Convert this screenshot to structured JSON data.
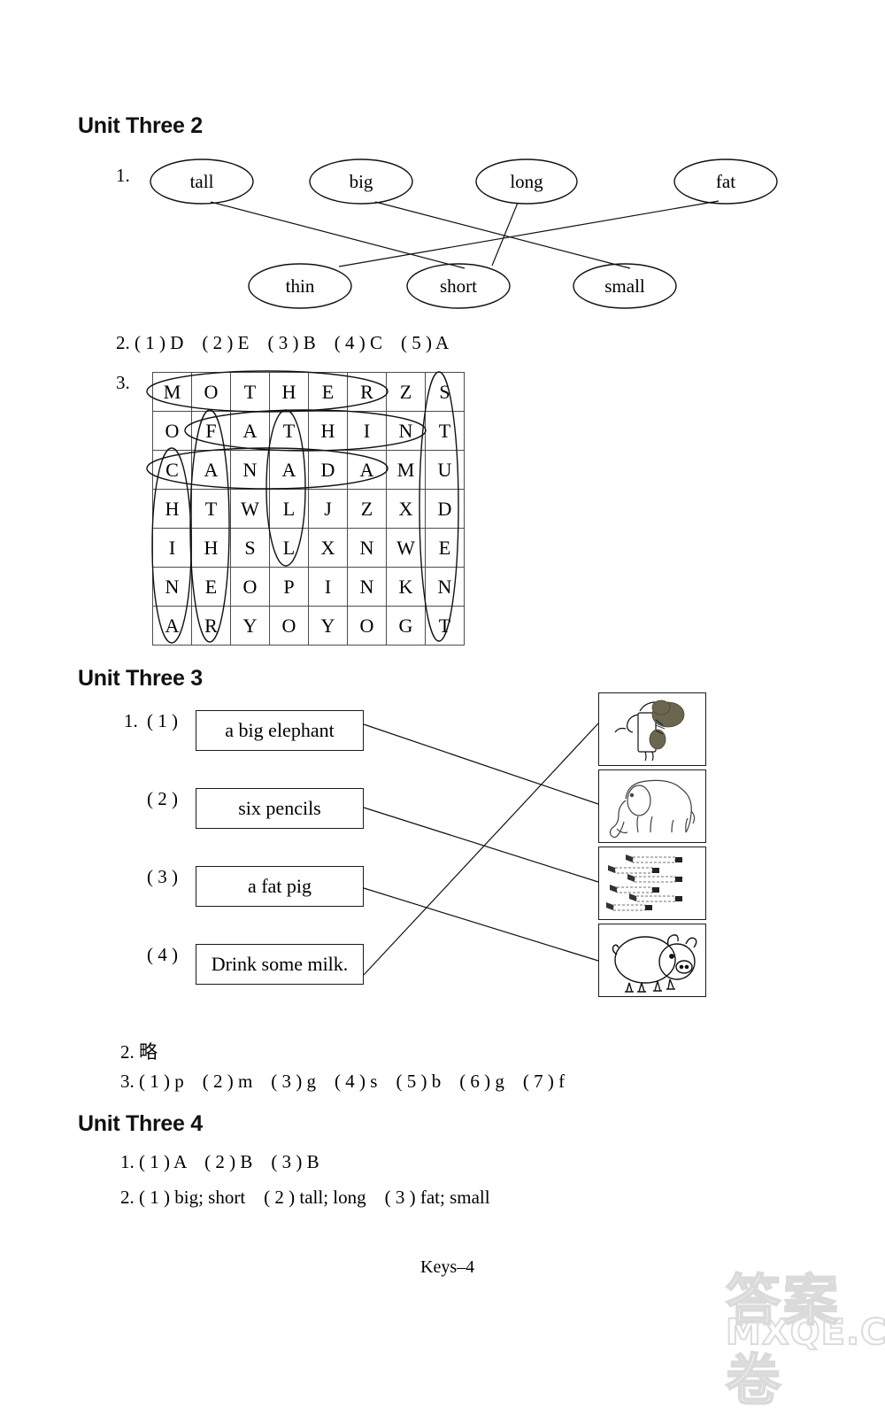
{
  "page": {
    "footer_label": "Keys–4",
    "watermark_cn": "答案卷",
    "watermark_en": "MXQE.COM"
  },
  "sections": [
    {
      "id": "unit-three-2",
      "title": "Unit Three 2"
    },
    {
      "id": "unit-three-3",
      "title": "Unit Three 3"
    },
    {
      "id": "unit-three-4",
      "title": "Unit Three 4"
    }
  ],
  "unit_three_2": {
    "q1": {
      "number": "1.",
      "top_words": [
        "tall",
        "big",
        "long",
        "fat"
      ],
      "bottom_words": [
        "thin",
        "short",
        "small"
      ],
      "matches": [
        {
          "from": "tall",
          "to": "short"
        },
        {
          "from": "big",
          "to": "small"
        },
        {
          "from": "long",
          "to": "short"
        },
        {
          "from": "fat",
          "to": "thin"
        }
      ]
    },
    "q2": {
      "number": "2.",
      "text": "2. ( 1 ) D    ( 2 ) E    ( 3 ) B    ( 4 ) C    ( 5 ) A"
    },
    "q3": {
      "number": "3.",
      "grid": [
        [
          "M",
          "O",
          "T",
          "H",
          "E",
          "R",
          "Z",
          "S"
        ],
        [
          "O",
          "F",
          "A",
          "T",
          "H",
          "I",
          "N",
          "T"
        ],
        [
          "C",
          "A",
          "N",
          "A",
          "D",
          "A",
          "M",
          "U"
        ],
        [
          "H",
          "T",
          "W",
          "L",
          "J",
          "Z",
          "X",
          "D"
        ],
        [
          "I",
          "H",
          "S",
          "L",
          "X",
          "N",
          "W",
          "E"
        ],
        [
          "N",
          "E",
          "O",
          "P",
          "I",
          "N",
          "K",
          "N"
        ],
        [
          "A",
          "R",
          "Y",
          "O",
          "Y",
          "O",
          "G",
          "T"
        ]
      ],
      "circled_words": [
        {
          "word": "MOTHER",
          "direction": "horizontal",
          "row": 1,
          "from_col": 1,
          "to_col": 6
        },
        {
          "word": "FATHIN",
          "direction": "horizontal",
          "row": 2,
          "from_col": 2,
          "to_col": 7
        },
        {
          "word": "CANADA",
          "direction": "horizontal",
          "row": 3,
          "from_col": 1,
          "to_col": 6
        },
        {
          "word": "CHINA",
          "direction": "vertical",
          "col": 1,
          "from_row": 3,
          "to_row": 7
        },
        {
          "word": "FATHER",
          "direction": "vertical",
          "col": 2,
          "from_row": 2,
          "to_row": 7
        },
        {
          "word": "TALL",
          "direction": "vertical",
          "col": 4,
          "from_row": 2,
          "to_row": 5
        },
        {
          "word": "STUDENT",
          "direction": "vertical",
          "col": 8,
          "from_row": 1,
          "to_row": 7
        }
      ]
    }
  },
  "unit_three_3": {
    "q1": {
      "number": "1.",
      "items": [
        {
          "label": "( 1 )",
          "phrase": "a big elephant",
          "picture": "milk-drinking-icon"
        },
        {
          "label": "( 2 )",
          "phrase": "six pencils",
          "picture": "elephant-icon"
        },
        {
          "label": "( 3 )",
          "phrase": "a fat pig",
          "picture": "pencils-icon"
        },
        {
          "label": "( 4 )",
          "phrase": "Drink some milk.",
          "picture": "pig-icon"
        }
      ],
      "pictures": [
        "milk-drinking-icon",
        "elephant-icon",
        "pencils-icon",
        "pig-icon"
      ],
      "matches": [
        {
          "from_item": 1,
          "to_picture": 2
        },
        {
          "from_item": 2,
          "to_picture": 3
        },
        {
          "from_item": 3,
          "to_picture": 4
        },
        {
          "from_item": 4,
          "to_picture": 1
        }
      ]
    },
    "q2": {
      "text": "2. 略"
    },
    "q3": {
      "text": "3. ( 1 ) p    ( 2 ) m    ( 3 ) g    ( 4 ) s    ( 5 ) b    ( 6 ) g    ( 7 ) f"
    }
  },
  "unit_three_4": {
    "q1": {
      "text": "1. ( 1 ) A    ( 2 ) B    ( 3 ) B"
    },
    "q2": {
      "text": "2. ( 1 ) big; short    ( 2 ) tall; long    ( 3 ) fat; small"
    }
  }
}
